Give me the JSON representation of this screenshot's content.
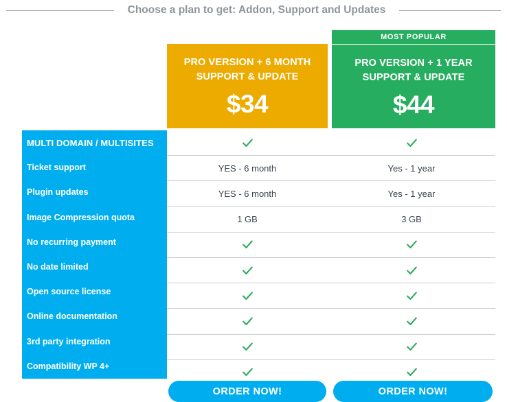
{
  "heading": {
    "text": "Choose a plan to get: Addon, Support and Updates"
  },
  "plans": [
    {
      "badge": "",
      "name_line1": "PRO VERSION + 6 MONTH",
      "name_line2": "SUPPORT & UPDATE",
      "price": "$34",
      "order_label": "ORDER NOW!",
      "accent_color": "#EDAB00"
    },
    {
      "badge": "MOST POPULAR",
      "name_line1": "PRO VERSION + 1 YEAR",
      "name_line2": "SUPPORT & UPDATE",
      "price": "$44",
      "order_label": "ORDER NOW!",
      "accent_color": "#27AD60"
    }
  ],
  "features": [
    {
      "label": "MULTI DOMAIN / MULTISITES",
      "a": "check",
      "b": "check"
    },
    {
      "label": "Ticket support",
      "a": "YES - 6 month",
      "b": "Yes - 1 year"
    },
    {
      "label": "Plugin updates",
      "a": "YES - 6 month",
      "b": "Yes - 1 year"
    },
    {
      "label": "Image Compression quota",
      "a": "1 GB",
      "b": "3 GB"
    },
    {
      "label": "No recurring payment",
      "a": "check",
      "b": "check"
    },
    {
      "label": "No date limited",
      "a": "check",
      "b": "check"
    },
    {
      "label": "Open source license",
      "a": "check",
      "b": "check"
    },
    {
      "label": "Online documentation",
      "a": "check",
      "b": "check"
    },
    {
      "label": "3rd party integration",
      "a": "check",
      "b": "check"
    },
    {
      "label": "Compatibility WP 4+",
      "a": "check",
      "b": "check"
    }
  ],
  "icons": {
    "check": "check-icon"
  },
  "colors": {
    "sidebar_blue": "#00AEEF",
    "plan_orange": "#EDAB00",
    "plan_green": "#27AD60",
    "check_green": "#2eaa5b",
    "heading_gray": "#8d959c",
    "row_divider": "#c9ccce"
  }
}
